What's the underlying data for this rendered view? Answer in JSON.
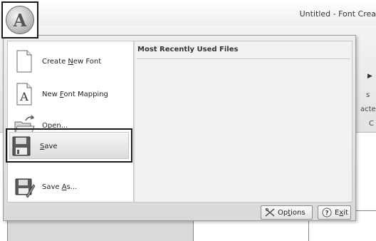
{
  "window": {
    "title": "Untitled - Font Crea"
  },
  "ribbon": {
    "peek_arrow": "▶",
    "peek_s": "s",
    "peek_acter": "acter",
    "peek_c": "C"
  },
  "app_button": {
    "letter": "A",
    "icon": "app-orb-icon"
  },
  "menu": {
    "items": [
      {
        "id": "create-new-font",
        "prefix": "Create ",
        "mnemonic": "N",
        "suffix": "ew Font",
        "icon": "new-document-icon"
      },
      {
        "id": "new-font-mapping",
        "prefix": "New ",
        "mnemonic": "F",
        "suffix": "ont Mapping",
        "icon": "font-mapping-icon"
      },
      {
        "id": "open",
        "prefix": "",
        "mnemonic": "O",
        "suffix": "pen...",
        "icon": "folder-open-icon"
      },
      {
        "id": "save",
        "prefix": "",
        "mnemonic": "S",
        "suffix": "ave",
        "icon": "floppy-disk-icon"
      },
      {
        "id": "save-as",
        "prefix": "Save ",
        "mnemonic": "A",
        "suffix": "s...",
        "icon": "floppy-disk-pen-icon"
      }
    ],
    "recent_heading": "Most Recently Used Files",
    "options_button": {
      "prefix": "Op",
      "mnemonic": "t",
      "suffix": "ions",
      "icon": "options-icon"
    },
    "exit_button": {
      "prefix": "E",
      "mnemonic": "x",
      "suffix": "it",
      "icon": "help-exit-icon"
    }
  }
}
